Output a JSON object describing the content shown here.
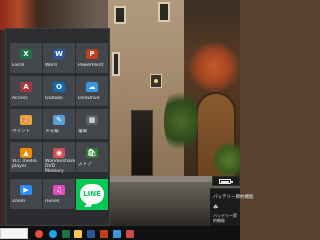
{
  "start_menu": {
    "tiles": [
      {
        "label": "Excel",
        "icon": "excel-icon",
        "glyph": "X",
        "color": "#1e7145"
      },
      {
        "label": "Word",
        "icon": "word-icon",
        "glyph": "W",
        "color": "#2b579a"
      },
      {
        "label": "PowerPoint",
        "icon": "powerpoint-icon",
        "glyph": "P",
        "color": "#c43e1c"
      },
      {
        "label": "Access",
        "icon": "access-icon",
        "glyph": "A",
        "color": "#a4373a"
      },
      {
        "label": "Outlook",
        "icon": "outlook-icon",
        "glyph": "O",
        "color": "#0f6cbd"
      },
      {
        "label": "OneDrive",
        "icon": "onedrive-icon",
        "glyph": "☁",
        "color": "#3a96dd"
      },
      {
        "label": "ペイント",
        "icon": "paint-icon",
        "glyph": "🎨",
        "color": "#e8a33a"
      },
      {
        "label": "メモ帳",
        "icon": "notepad-icon",
        "glyph": "✎",
        "color": "#5aa0d8"
      },
      {
        "label": "電卓",
        "icon": "calculator-icon",
        "glyph": "▦",
        "color": "#5b5f64"
      },
      {
        "label": "VLC media player",
        "icon": "vlc-icon",
        "glyph": "▲",
        "color": "#f08a00"
      },
      {
        "label": "Wondershare DVD Memory",
        "icon": "dvd-memory-icon",
        "glyph": "◉",
        "color": "#d05050"
      },
      {
        "label": "ストア",
        "icon": "store-icon",
        "glyph": "🛍",
        "color": "#2e7d32"
      },
      {
        "label": "Zoom",
        "icon": "zoom-icon",
        "glyph": "▶",
        "color": "#2d8cff"
      },
      {
        "label": "iTunes",
        "icon": "itunes-icon",
        "glyph": "♫",
        "color": "#e24bb8"
      }
    ],
    "line_tile": {
      "label": "LINE",
      "badge": "LINE",
      "color": "#06c755"
    }
  },
  "battery": {
    "icon": "battery-icon",
    "level_percent": 80
  },
  "power_panel": {
    "title": "バッテリー節約機能",
    "mode_icon": "leaf-icon",
    "mode_text": "バッテリー節約機能"
  },
  "taskbar": {
    "search_placeholder": "",
    "icons": [
      {
        "name": "chrome-taskbar-icon",
        "color": "#e84e3c"
      },
      {
        "name": "edge-taskbar-icon",
        "color": "#1ca5e8"
      },
      {
        "name": "excel-taskbar-icon",
        "color": "#1e7145"
      },
      {
        "name": "explorer-taskbar-icon",
        "color": "#f2c94c"
      },
      {
        "name": "word-taskbar-icon",
        "color": "#2b579a"
      },
      {
        "name": "powerpoint-taskbar-icon",
        "color": "#c43e1c"
      },
      {
        "name": "onedrive-taskbar-icon",
        "color": "#3a96dd"
      },
      {
        "name": "app-taskbar-icon",
        "color": "#d04a4a"
      }
    ]
  }
}
